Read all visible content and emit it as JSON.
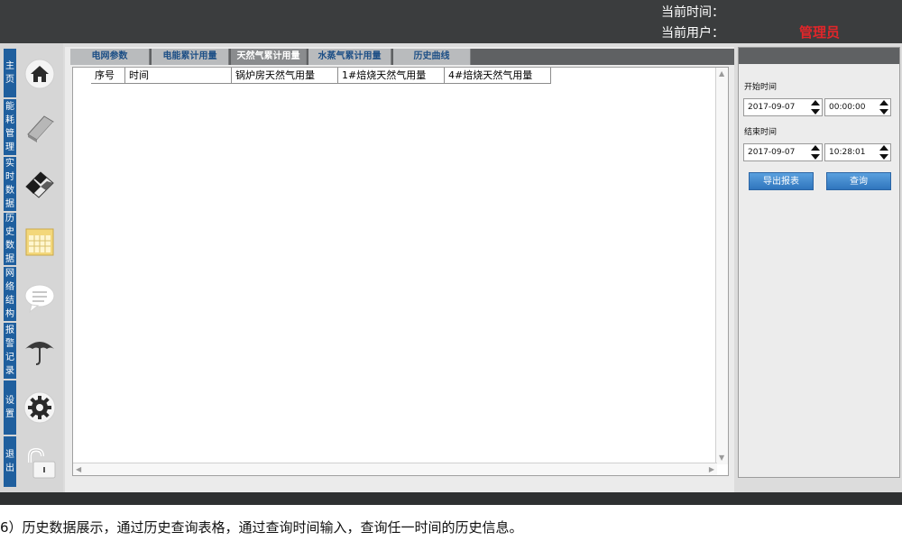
{
  "header": {
    "time_label": "当前时间：",
    "user_label": "当前用户：",
    "user_value": "管理员",
    "user_value_color": "#e0262a"
  },
  "sidebar": {
    "items": [
      {
        "label": "主页",
        "icon": "home-icon"
      },
      {
        "label": "能耗管理",
        "icon": "notebook-icon"
      },
      {
        "label": "实时数据",
        "icon": "monitor-icon"
      },
      {
        "label": "历史数据",
        "icon": "calendar-icon"
      },
      {
        "label": "网络结构",
        "icon": "chat-bubble-icon"
      },
      {
        "label": "报警记录",
        "icon": "umbrella-icon"
      },
      {
        "label": "设置",
        "icon": "gear-icon"
      },
      {
        "label": "退出",
        "icon": "unlock-icon"
      }
    ],
    "tab_color": "#1f5f9e"
  },
  "tabs": {
    "items": [
      "电网参数",
      "电能累计用量",
      "天然气累计用量",
      "水蒸气累计用量",
      "历史曲线"
    ],
    "active": "天然气累计用量"
  },
  "table": {
    "columns": [
      "序号",
      "时间",
      "锅炉房天然气用量",
      "1#焙烧天然气用量",
      "4#焙烧天然气用量"
    ],
    "rows": []
  },
  "query_panel": {
    "start_label": "开始时间",
    "start_date": "2017-09-07",
    "start_time": "00:00:00",
    "end_label": "结束时间",
    "end_date": "2017-09-07",
    "end_time": "10:28:01",
    "export_button": "导出报表",
    "query_button": "查询"
  },
  "caption": "6）历史数据展示，通过历史查询表格，通过查询时间输入，查询任一时间的历史信息。"
}
